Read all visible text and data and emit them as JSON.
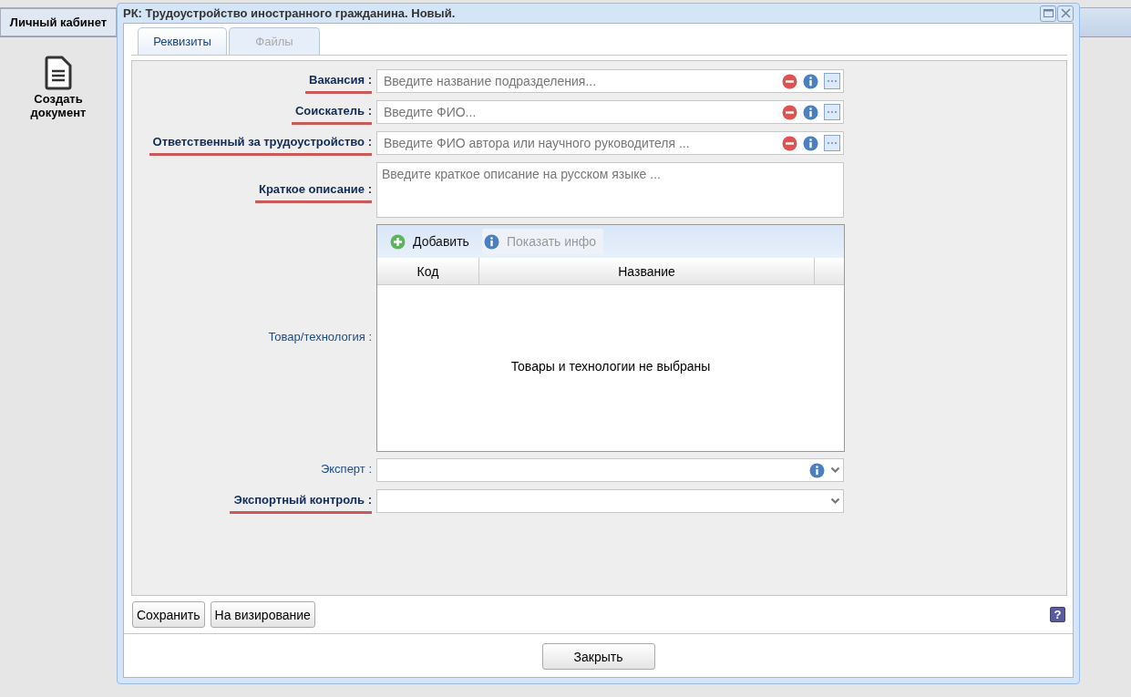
{
  "page": {
    "header_title": "Личный кабинет",
    "sidebar_action": "Создать документ"
  },
  "dialog": {
    "title": "РК: Трудоустройство иностранного гражданина. Новый."
  },
  "tabs": [
    {
      "label": "Реквизиты",
      "selected": true
    },
    {
      "label": "Файлы",
      "selected": false
    }
  ],
  "fields": [
    {
      "kind": "lookup",
      "label": "Вакансия :",
      "required": true,
      "placeholder": "Введите название подразделения..."
    },
    {
      "kind": "lookup",
      "label": "Соискатель :",
      "required": true,
      "placeholder": "Введите ФИО..."
    },
    {
      "kind": "lookup",
      "label": "Ответственный за трудоустройство :",
      "required": true,
      "placeholder": "Введите ФИО автора или научного руководителя ..."
    },
    {
      "kind": "textarea",
      "label": "Краткое описание :",
      "required": true,
      "placeholder": "Введите краткое описание на русском языке ..."
    },
    {
      "kind": "grid",
      "label": "Товар/технология :",
      "required": false,
      "toolbar": [
        {
          "label": "Добавить",
          "disabled": false
        },
        {
          "label": "Показать инфо",
          "disabled": true
        }
      ],
      "columns": [
        "Код",
        "Название"
      ],
      "empty_text": "Товары и технологии не выбраны"
    },
    {
      "kind": "select",
      "label": "Эксперт :",
      "required": false,
      "info": true
    },
    {
      "kind": "select",
      "label": "Экспортный контроль :",
      "required": true,
      "info": false
    }
  ],
  "buttons": [
    "Сохранить",
    "На визирование"
  ],
  "help_button": "?",
  "close_button": "Закрыть"
}
